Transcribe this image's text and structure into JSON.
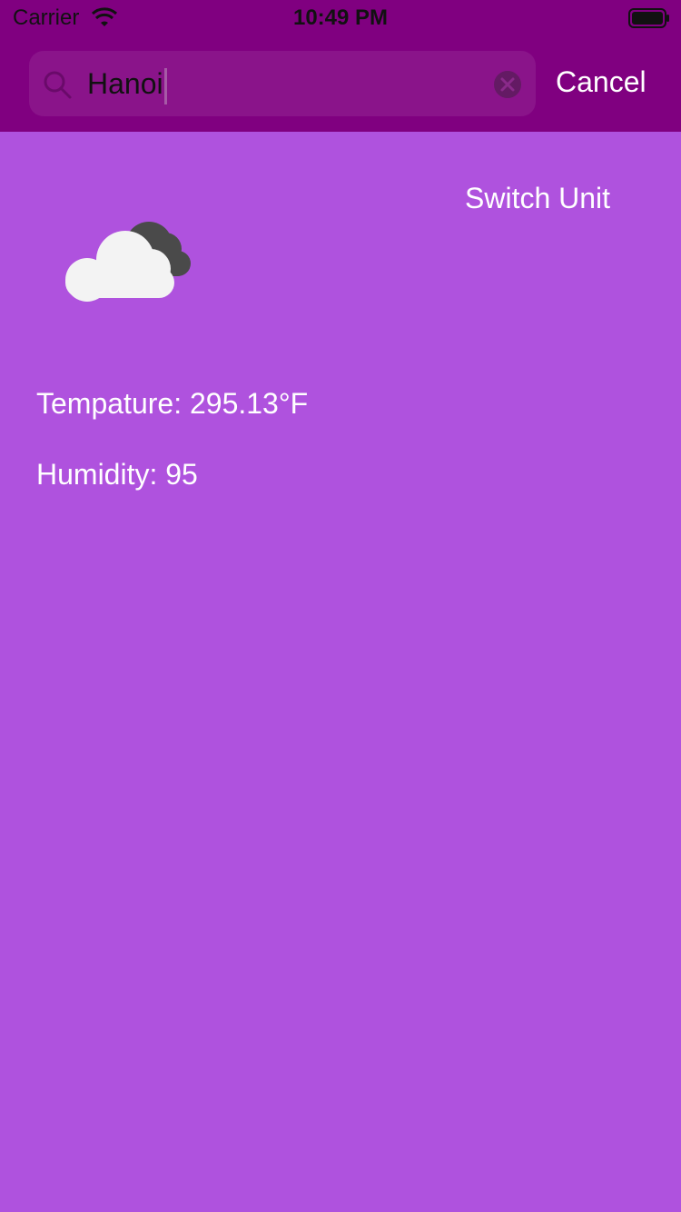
{
  "status_bar": {
    "carrier": "Carrier",
    "time": "10:49 PM",
    "wifi_icon": "wifi-icon",
    "battery_icon": "battery-icon"
  },
  "search": {
    "value": "Hanoi",
    "icon": "search-icon",
    "clear_icon": "clear-icon",
    "cancel_label": "Cancel"
  },
  "main": {
    "switch_unit_label": "Switch Unit",
    "weather_icon": "cloudy-icon",
    "temperature_text": "Tempature: 295.13°F",
    "humidity_text": "Humidity: 95"
  },
  "colors": {
    "header_bg": "#800080",
    "body_bg": "#af52de",
    "text_light": "#ffffff"
  }
}
